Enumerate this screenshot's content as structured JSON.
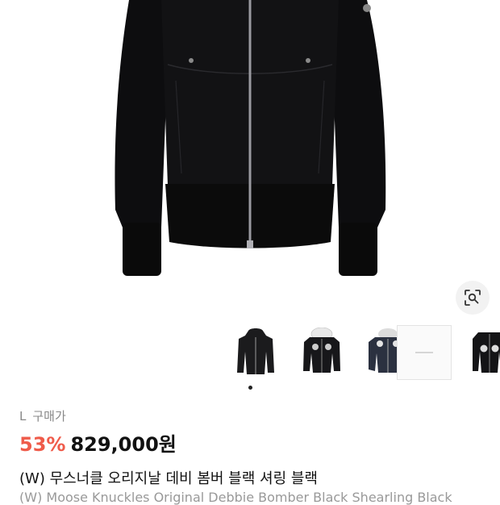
{
  "product": {
    "size_label": "L",
    "purchase_label": "구매가",
    "discount": "53%",
    "price": "829,000원",
    "title_ko": "(W) 무스너클 오리지날 데비 봄버 블랙 셔링 블랙",
    "title_en": "(W) Moose Knuckles Original Debbie Bomber Black Shearling Black"
  },
  "gallery": {
    "active_index": 0,
    "thumbs": [
      {
        "name": "thumb-hooded-jacket"
      },
      {
        "name": "thumb-fur-bomber"
      },
      {
        "name": "thumb-navy-bomber"
      },
      {
        "name": "thumb-blank-card"
      },
      {
        "name": "thumb-fur-bomber-2"
      }
    ]
  },
  "icons": {
    "lens": "image-search-icon"
  }
}
